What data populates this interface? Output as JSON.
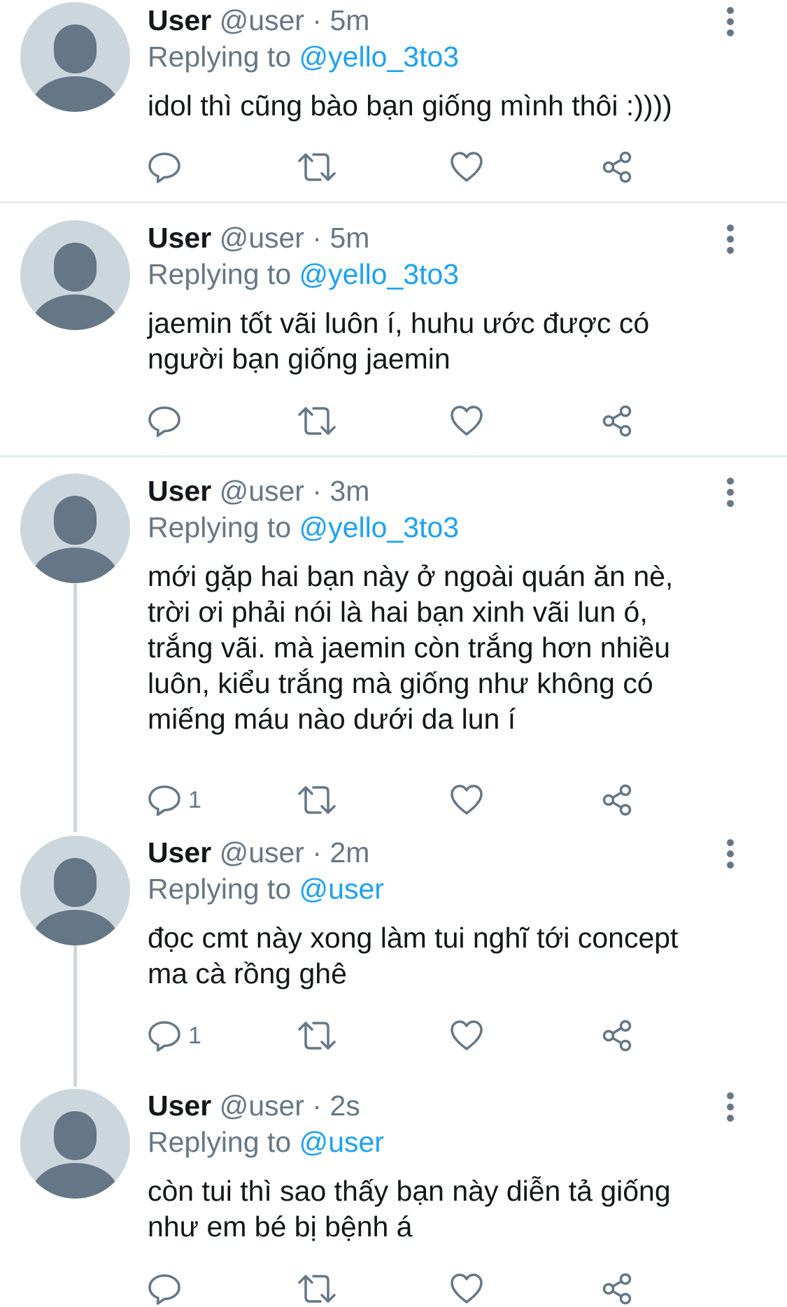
{
  "colors": {
    "text": "#14171a",
    "muted": "#657786",
    "link": "#1da1f2",
    "avatar_bg": "#ccd6dd",
    "avatar_fg": "#657786",
    "divider": "#e6ecf0"
  },
  "tweets": [
    {
      "name": "User",
      "handle": "@user",
      "separator": "·",
      "time": "5m",
      "replying_prefix": "Replying to",
      "replying_handle": "@yello_3to3",
      "lines": [
        "idol thì cũng bào bạn giống mình thôi :))))"
      ],
      "reply_count": "",
      "icons": [
        "reply-icon",
        "retweet-icon",
        "like-icon",
        "share-icon",
        "more-icon"
      ]
    },
    {
      "name": "User",
      "handle": "@user",
      "separator": "·",
      "time": "5m",
      "replying_prefix": "Replying to",
      "replying_handle": "@yello_3to3",
      "lines": [
        "jaemin tốt vãi luôn í, huhu ước được có",
        "người bạn giống jaemin"
      ],
      "reply_count": "",
      "icons": [
        "reply-icon",
        "retweet-icon",
        "like-icon",
        "share-icon",
        "more-icon"
      ]
    },
    {
      "name": "User",
      "handle": "@user",
      "separator": "·",
      "time": "3m",
      "replying_prefix": "Replying to",
      "replying_handle": "@yello_3to3",
      "lines": [
        "mới gặp hai bạn này ở ngoài quán ăn nè,",
        "trời ơi phải nói là hai bạn xinh vãi lun ó,",
        "trắng vãi. mà jaemin còn trắng hơn nhiều",
        "luôn, kiểu trắng mà giống như không có",
        "miếng máu nào dưới da lun í"
      ],
      "reply_count": "1",
      "icons": [
        "reply-icon",
        "retweet-icon",
        "like-icon",
        "share-icon",
        "more-icon"
      ]
    },
    {
      "name": "User",
      "handle": "@user",
      "separator": "·",
      "time": "2m",
      "replying_prefix": "Replying to",
      "replying_handle": "@user",
      "lines": [
        "đọc cmt này xong làm tui nghĩ tới concept",
        "ma cà rồng ghê"
      ],
      "reply_count": "1",
      "icons": [
        "reply-icon",
        "retweet-icon",
        "like-icon",
        "share-icon",
        "more-icon"
      ]
    },
    {
      "name": "User",
      "handle": "@user",
      "separator": "·",
      "time": "2s",
      "replying_prefix": "Replying to",
      "replying_handle": "@user",
      "lines": [
        "còn tui thì sao thấy bạn này diễn tả giống",
        "như em bé bị bệnh á"
      ],
      "reply_count": "",
      "icons": [
        "reply-icon",
        "retweet-icon",
        "like-icon",
        "share-icon",
        "more-icon"
      ]
    }
  ]
}
